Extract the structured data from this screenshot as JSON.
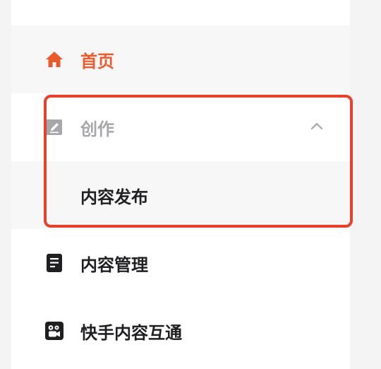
{
  "sidebar": {
    "items": [
      {
        "label": "首页",
        "icon": "home-icon",
        "active": true
      },
      {
        "label": "创作",
        "icon": "edit-icon",
        "expanded": true,
        "children": [
          {
            "label": "内容发布"
          }
        ]
      },
      {
        "label": "内容管理",
        "icon": "document-icon"
      },
      {
        "label": "快手内容互通",
        "icon": "kuaishou-icon"
      }
    ]
  },
  "colors": {
    "accent": "#ea5b2c",
    "highlight_border": "#e8402a",
    "muted_text": "#a7a7ab",
    "primary_text": "#1f1f22",
    "item_bg_active": "#f7f7f8"
  }
}
